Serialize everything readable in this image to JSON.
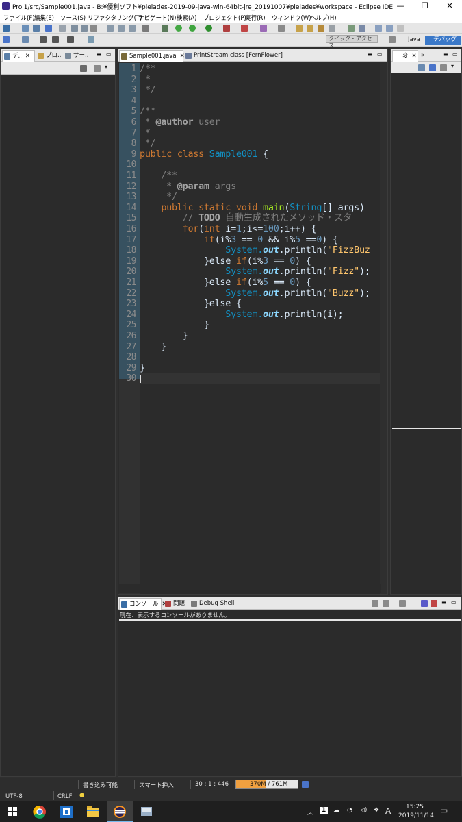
{
  "window": {
    "title": "Proj1/src/Sample001.java - B:¥便利ソフト¥pleiades-2019-09-java-win-64bit-jre_20191007¥pleiades¥workspace - Eclipse IDE",
    "minimize": "—",
    "maximize": "❐",
    "close": "✕"
  },
  "menu": [
    "ファイル(F)",
    "編集(E)",
    "ソース(S)",
    "リファクタリング(T)",
    "ナビゲート(N)",
    "検索(A)",
    "プロジェクト(P)",
    "実行(R)",
    "ウィンドウ(W)",
    "ヘルプ(H)"
  ],
  "toolbar": {
    "quick_access": "クイック・アクセス",
    "perspectives": [
      "Java",
      "デバッグ"
    ]
  },
  "left_view": {
    "tabs": [
      "デ..",
      "プロ..",
      "サー.."
    ]
  },
  "right_view": {
    "tabs": [
      "変",
      "»"
    ]
  },
  "editor": {
    "tabs": [
      "Sample001.java",
      "PrintStream.class [FernFlower]"
    ],
    "line_numbers": [
      "1",
      "2",
      "3",
      "4",
      "5",
      "6",
      "7",
      "8",
      "9",
      "10",
      "11",
      "12",
      "13",
      "14",
      "15",
      "16",
      "17",
      "18",
      "19",
      "20",
      "21",
      "22",
      "23",
      "24",
      "25",
      "26",
      "27",
      "28",
      "29",
      "30"
    ],
    "code": {
      "l1": "/**",
      "l2": " *",
      "l3": " */",
      "l5": "/**",
      "l6_tag": "@author",
      "l6_val": " user",
      "l7": " *",
      "l8": " */",
      "l9_kw": "public class ",
      "l9_cls": "Sample001",
      "l9_rest": " {",
      "l11": "    /**",
      "l12_tag": "@param",
      "l12_val": " args",
      "l13": "     */",
      "l14_kw": "public static void ",
      "l14_fn": "main",
      "l14_cls": "String",
      "l14_rest": "[] args)",
      "l15_todo": "TODO",
      "l15_msg": " 自動生成されたメソッド・スタ",
      "l16_for": "for",
      "l16_int": "int",
      "l16_cond": " i=",
      "l16_n1": "1",
      "l16_mid": ";i<=",
      "l16_n2": "100",
      "l16_end": ";i++) {",
      "l17_if": "if",
      "l17_a": "(i%",
      "l17_n1": "3",
      "l17_b": " == ",
      "l17_n2": "0",
      "l17_c": " && i%",
      "l17_n3": "5",
      "l17_d": " ==",
      "l17_n4": "0",
      "l17_e": ") {",
      "sys": "System.",
      "out": "out",
      "println": ".println(",
      "l18_str": "\"FizzBuz",
      "l19_a": "}else ",
      "l19_if": "if",
      "l19_b": "(i%",
      "l19_n": "3",
      "l19_c": " == ",
      "l19_z": "0",
      "l19_d": ") {",
      "l20_str": "\"Fizz\"",
      "l20_end": ");",
      "l21_n": "5",
      "l22_str": "\"Buzz\"",
      "l23_a": "}else ",
      "l23_b": "{",
      "l24_arg": "i);",
      "close": "}"
    }
  },
  "console": {
    "tabs": [
      "コンソール",
      "問題",
      "Debug Shell"
    ],
    "message": "現在、表示するコンソールがありません。"
  },
  "status": {
    "writable": "書き込み可能",
    "insert": "スマート挿入",
    "position": "30 : 1 : 446",
    "heap": "370M / 761M",
    "heap_used_fraction": 0.486,
    "encoding": "UTF-8",
    "line_ending": "CRLF"
  },
  "taskbar": {
    "time": "15:25",
    "date": "2019/11/14",
    "ime": "A",
    "notification_count": "1"
  },
  "colors": {
    "keyword": "#cc7832",
    "class": "#1290c3",
    "method": "#a7ec21",
    "string": "#ffc66d",
    "number": "#6897bb",
    "comment": "#7f7f7f"
  }
}
